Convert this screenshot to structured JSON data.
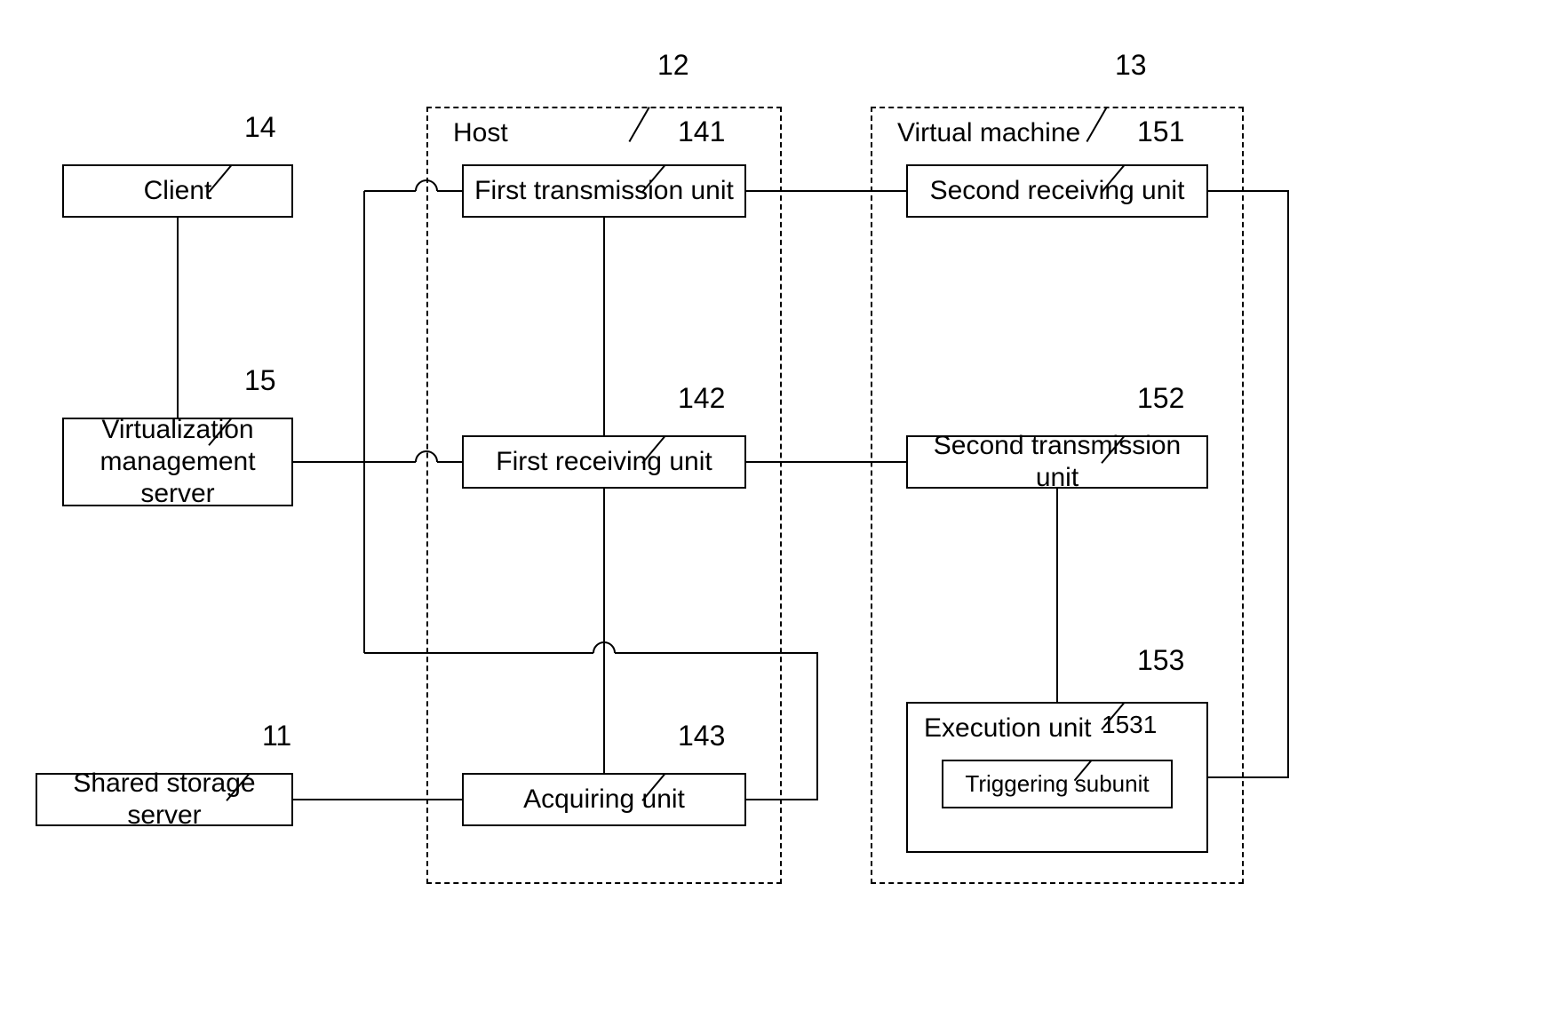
{
  "diagram": {
    "client": {
      "ref": "14",
      "label": "Client"
    },
    "vms": {
      "ref": "15",
      "label": "Virtualization management server"
    },
    "shared": {
      "ref": "11",
      "label": "Shared storage server"
    },
    "host": {
      "ref": "12",
      "title": "Host",
      "first_tx": {
        "ref": "141",
        "label": "First transmission unit"
      },
      "first_rx": {
        "ref": "142",
        "label": "First receiving unit"
      },
      "acquiring": {
        "ref": "143",
        "label": "Acquiring unit"
      }
    },
    "vm": {
      "ref": "13",
      "title": "Virtual machine",
      "second_rx": {
        "ref": "151",
        "label": "Second receiving unit"
      },
      "second_tx": {
        "ref": "152",
        "label": "Second transmission unit"
      },
      "exec": {
        "ref": "153",
        "label": "Execution unit",
        "trigger": {
          "ref": "1531",
          "label": "Triggering subunit"
        }
      }
    }
  }
}
